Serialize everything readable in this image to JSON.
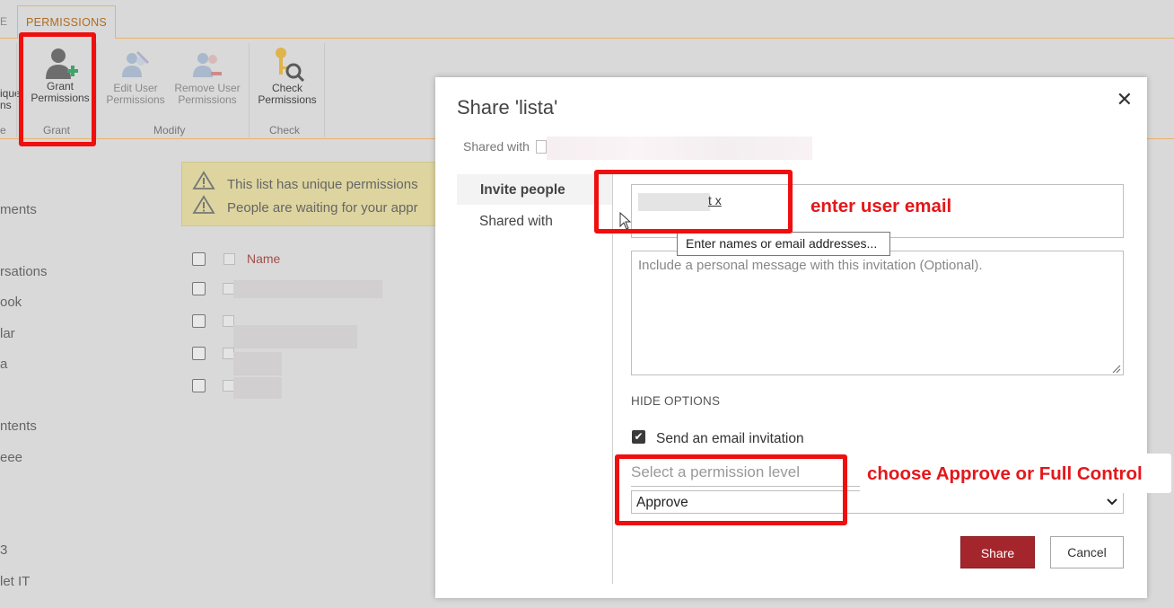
{
  "ribbon": {
    "active_tab": "PERMISSIONS",
    "prev_tab_fragment": "E",
    "buttons": [
      {
        "label1": "Grant",
        "label2": "Permissions",
        "icon": "grant-permissions-icon"
      },
      {
        "label1": "Edit User",
        "label2": "Permissions",
        "icon": "edit-user-permissions-icon"
      },
      {
        "label1": "Remove User",
        "label2": "Permissions",
        "icon": "remove-user-permissions-icon"
      },
      {
        "label1": "Check",
        "label2": "Permissions",
        "icon": "check-permissions-icon"
      }
    ],
    "partial_button": {
      "label1": "ique",
      "label2": "ns"
    },
    "groups": [
      "e",
      "Grant",
      "Modify",
      "Check"
    ]
  },
  "left_nav": [
    "ments",
    "rsations",
    "ook",
    "lar",
    "a",
    "ntents",
    "eee",
    "3",
    "let IT"
  ],
  "notice": {
    "line1": "This list has unique permissions",
    "line2": "People are waiting for your appr"
  },
  "list": {
    "column_name": "Name"
  },
  "dialog": {
    "title": "Share 'lista'",
    "close": "✕",
    "shared_with_label": "Shared with",
    "side_tabs": [
      "Invite people",
      "Shared with"
    ],
    "people_token": "t x",
    "tooltip": "Enter names or email addresses...",
    "message_placeholder": "Include a personal message with this invitation (Optional).",
    "hide_options": "HIDE OPTIONS",
    "send_email_label": "Send an email invitation",
    "send_email_checked": true,
    "permission_label": "Select a permission level",
    "permission_value": "Approve",
    "share_button": "Share",
    "cancel_button": "Cancel"
  },
  "annotations": {
    "email": "enter user email",
    "permission": "choose Approve or Full Control"
  },
  "colors": {
    "accent_orange": "#b06b21",
    "share_button": "#a4262c",
    "annotation_red": "#e3171b"
  }
}
